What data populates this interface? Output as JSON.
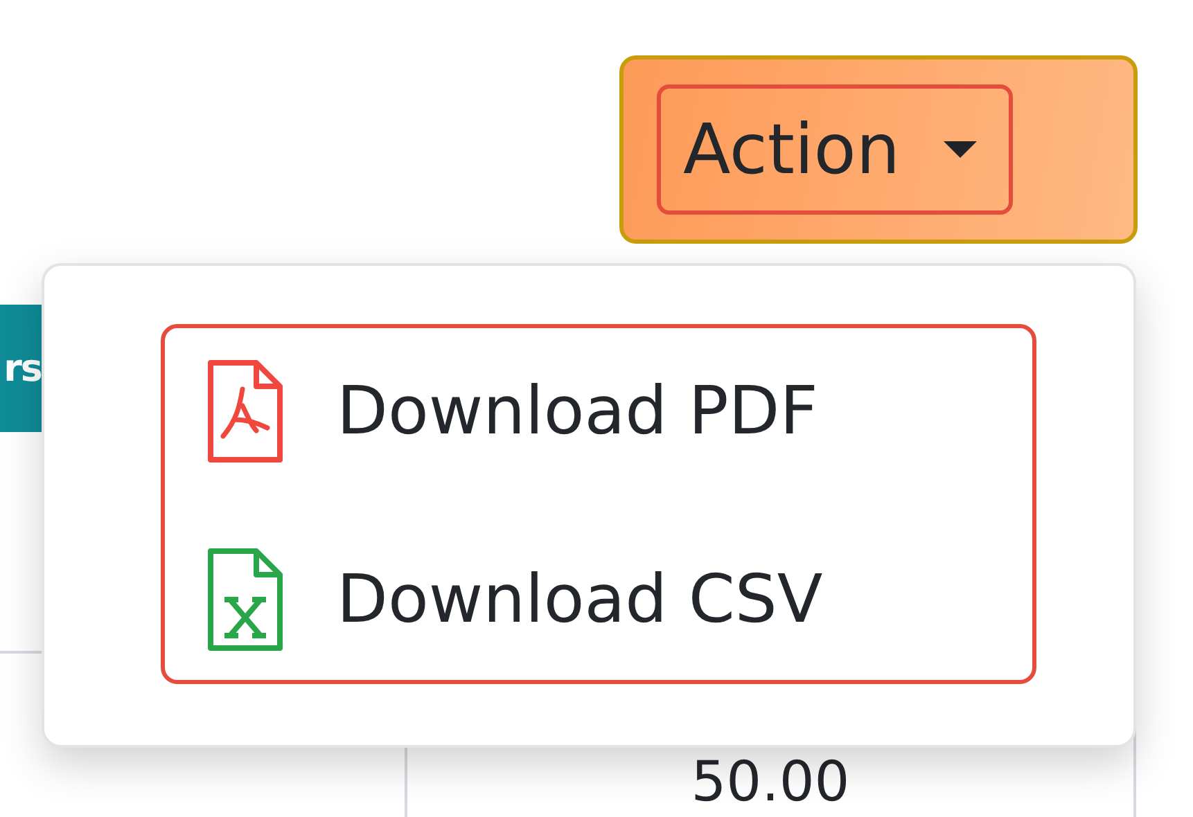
{
  "action_button": {
    "label": "Action"
  },
  "table": {
    "header_cell": "rs",
    "cell": "50.00"
  },
  "menu": {
    "items": [
      {
        "label": "Download PDF",
        "kind": "pdf"
      },
      {
        "label": "Download CSV",
        "kind": "csv"
      }
    ]
  }
}
